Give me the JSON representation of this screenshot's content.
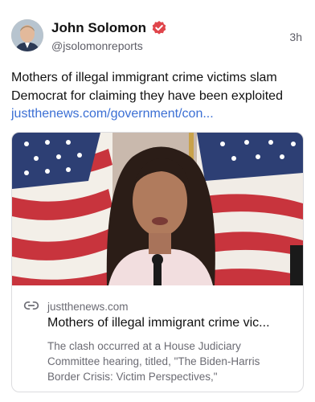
{
  "post": {
    "author_name": "John Solomon",
    "handle": "@jsolomonreports",
    "time": "3h",
    "text": "Mothers of illegal immigrant crime victims slam Democrat for claiming they have been exploited ",
    "link_text": "justthenews.com/government/con...",
    "verified_color": "#e0454b"
  },
  "card": {
    "domain": "justthenews.com",
    "title": "Mothers of illegal immigrant crime vic...",
    "description": "The clash occurred at a House Judiciary Committee hearing, titled, \"The Biden-Harris Border Crisis: Victim Perspectives,\""
  }
}
